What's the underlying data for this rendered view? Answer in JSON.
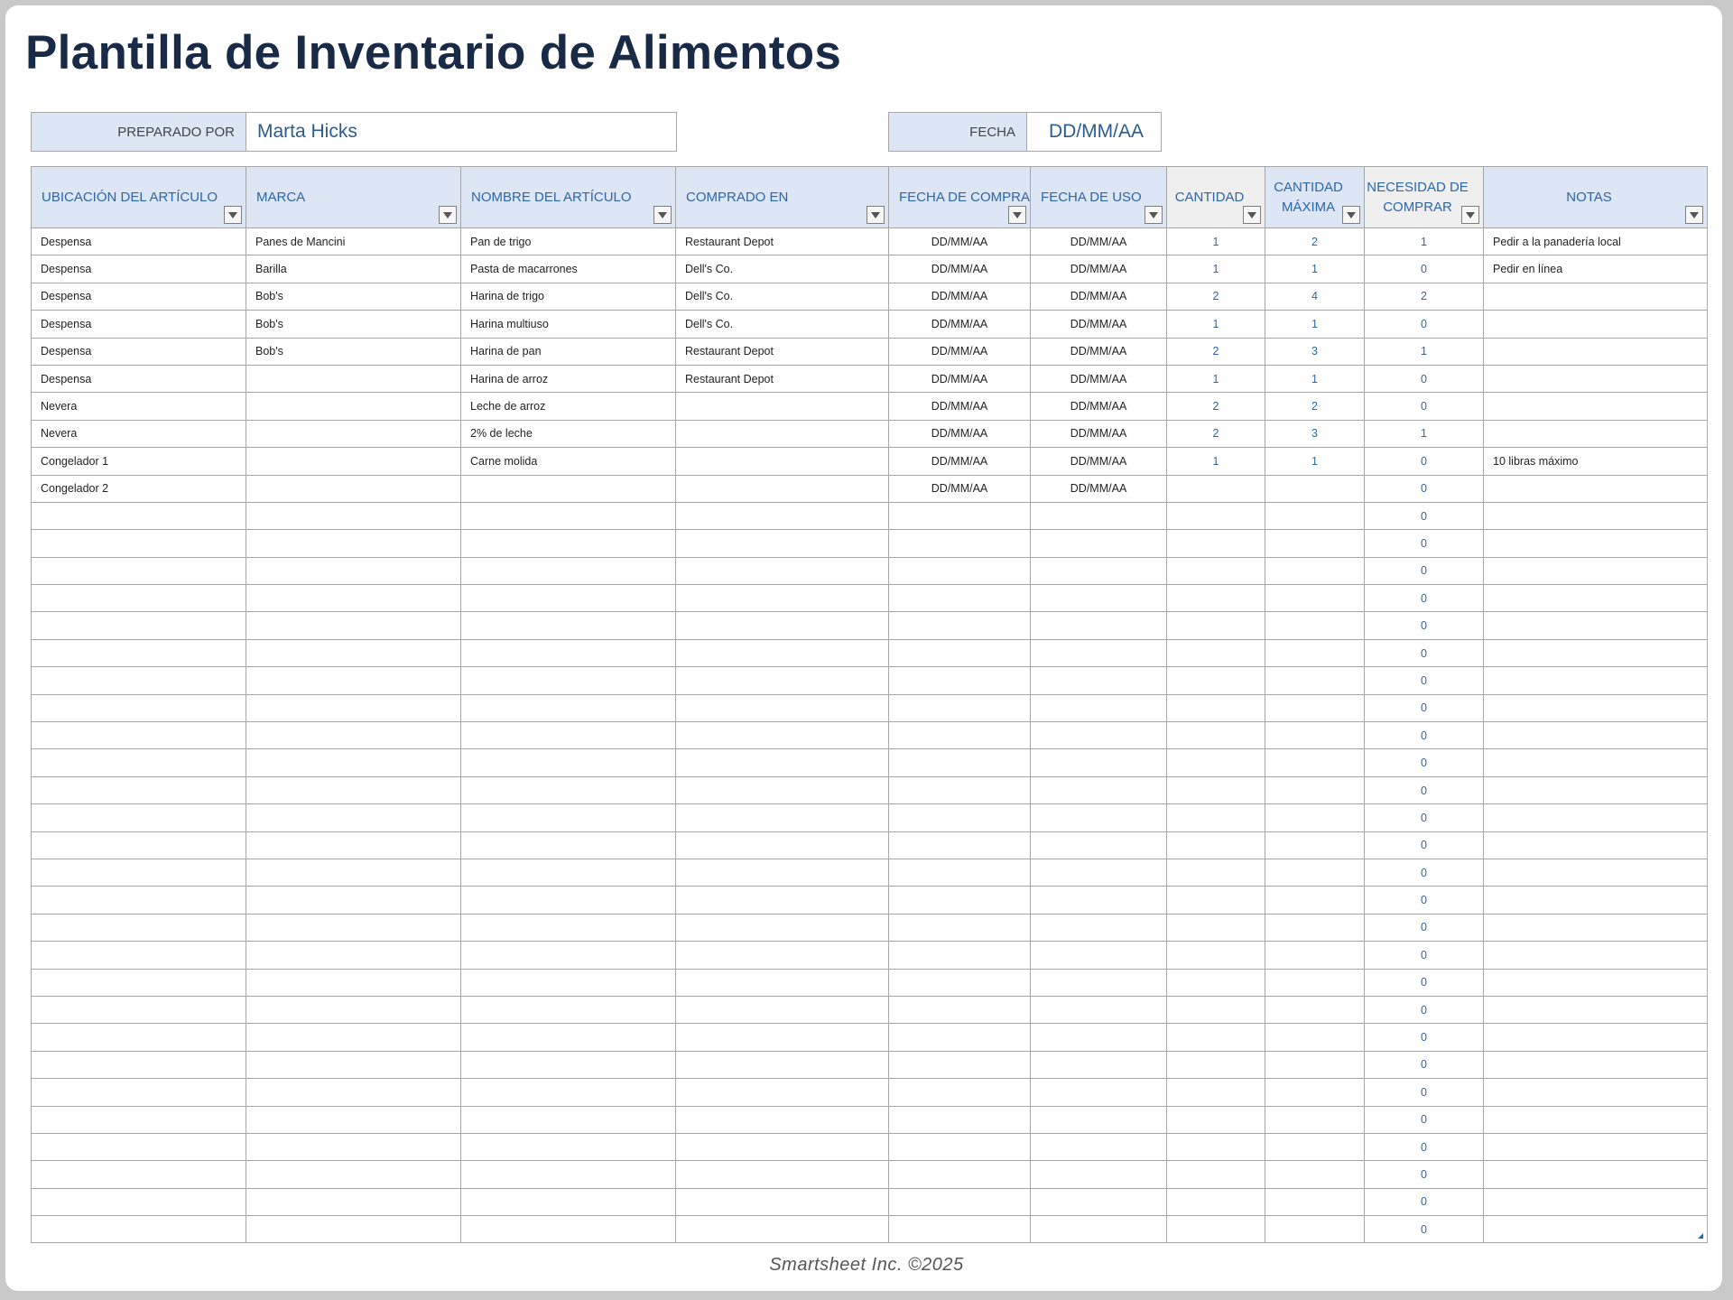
{
  "title": "Plantilla de Inventario de Alimentos",
  "prepared_by": {
    "label": "PREPARADO POR",
    "value": "Marta Hicks"
  },
  "date": {
    "label": "FECHA",
    "value": "DD/MM/AA"
  },
  "columns": [
    "UBICACIÓN DEL ARTÍCULO",
    "MARCA",
    "NOMBRE DEL ARTÍCULO",
    "COMPRADO EN",
    "FECHA DE COMPRA",
    "FECHA DE USO",
    "CANTIDAD",
    "CANTIDAD MÁXIMA",
    "NECESIDAD DE COMPRAR",
    "NOTAS"
  ],
  "rows": [
    [
      "Despensa",
      "Panes de Mancini",
      "Pan de trigo",
      "Restaurant Depot",
      "DD/MM/AA",
      "DD/MM/AA",
      "1",
      "2",
      "1",
      "Pedir a la panadería local"
    ],
    [
      "Despensa",
      "Barilla",
      "Pasta de macarrones",
      "Dell's Co.",
      "DD/MM/AA",
      "DD/MM/AA",
      "1",
      "1",
      "0",
      "Pedir en línea"
    ],
    [
      "Despensa",
      "Bob's",
      "Harina de trigo",
      "Dell's Co.",
      "DD/MM/AA",
      "DD/MM/AA",
      "2",
      "4",
      "2",
      ""
    ],
    [
      "Despensa",
      "Bob's",
      "Harina multiuso",
      "Dell's Co.",
      "DD/MM/AA",
      "DD/MM/AA",
      "1",
      "1",
      "0",
      ""
    ],
    [
      "Despensa",
      "Bob's",
      "Harina de pan",
      "Restaurant Depot",
      "DD/MM/AA",
      "DD/MM/AA",
      "2",
      "3",
      "1",
      ""
    ],
    [
      "Despensa",
      "",
      "Harina de arroz",
      "Restaurant Depot",
      "DD/MM/AA",
      "DD/MM/AA",
      "1",
      "1",
      "0",
      ""
    ],
    [
      "Nevera",
      "",
      "Leche de arroz",
      "",
      "DD/MM/AA",
      "DD/MM/AA",
      "2",
      "2",
      "0",
      ""
    ],
    [
      "Nevera",
      "",
      "2% de leche",
      "",
      "DD/MM/AA",
      "DD/MM/AA",
      "2",
      "3",
      "1",
      ""
    ],
    [
      "Congelador 1",
      "",
      "Carne molida",
      "",
      "DD/MM/AA",
      "DD/MM/AA",
      "1",
      "1",
      "0",
      "10 libras máximo"
    ],
    [
      "Congelador 2",
      "",
      "",
      "",
      "DD/MM/AA",
      "DD/MM/AA",
      "",
      "",
      "0",
      ""
    ],
    [
      "",
      "",
      "",
      "",
      "",
      "",
      "",
      "",
      "0",
      ""
    ],
    [
      "",
      "",
      "",
      "",
      "",
      "",
      "",
      "",
      "0",
      ""
    ],
    [
      "",
      "",
      "",
      "",
      "",
      "",
      "",
      "",
      "0",
      ""
    ],
    [
      "",
      "",
      "",
      "",
      "",
      "",
      "",
      "",
      "0",
      ""
    ],
    [
      "",
      "",
      "",
      "",
      "",
      "",
      "",
      "",
      "0",
      ""
    ],
    [
      "",
      "",
      "",
      "",
      "",
      "",
      "",
      "",
      "0",
      ""
    ],
    [
      "",
      "",
      "",
      "",
      "",
      "",
      "",
      "",
      "0",
      ""
    ],
    [
      "",
      "",
      "",
      "",
      "",
      "",
      "",
      "",
      "0",
      ""
    ],
    [
      "",
      "",
      "",
      "",
      "",
      "",
      "",
      "",
      "0",
      ""
    ],
    [
      "",
      "",
      "",
      "",
      "",
      "",
      "",
      "",
      "0",
      ""
    ],
    [
      "",
      "",
      "",
      "",
      "",
      "",
      "",
      "",
      "0",
      ""
    ],
    [
      "",
      "",
      "",
      "",
      "",
      "",
      "",
      "",
      "0",
      ""
    ],
    [
      "",
      "",
      "",
      "",
      "",
      "",
      "",
      "",
      "0",
      ""
    ],
    [
      "",
      "",
      "",
      "",
      "",
      "",
      "",
      "",
      "0",
      ""
    ],
    [
      "",
      "",
      "",
      "",
      "",
      "",
      "",
      "",
      "0",
      ""
    ],
    [
      "",
      "",
      "",
      "",
      "",
      "",
      "",
      "",
      "0",
      ""
    ],
    [
      "",
      "",
      "",
      "",
      "",
      "",
      "",
      "",
      "0",
      ""
    ],
    [
      "",
      "",
      "",
      "",
      "",
      "",
      "",
      "",
      "0",
      ""
    ],
    [
      "",
      "",
      "",
      "",
      "",
      "",
      "",
      "",
      "0",
      ""
    ],
    [
      "",
      "",
      "",
      "",
      "",
      "",
      "",
      "",
      "0",
      ""
    ],
    [
      "",
      "",
      "",
      "",
      "",
      "",
      "",
      "",
      "0",
      ""
    ],
    [
      "",
      "",
      "",
      "",
      "",
      "",
      "",
      "",
      "0",
      ""
    ],
    [
      "",
      "",
      "",
      "",
      "",
      "",
      "",
      "",
      "0",
      ""
    ],
    [
      "",
      "",
      "",
      "",
      "",
      "",
      "",
      "",
      "0",
      ""
    ],
    [
      "",
      "",
      "",
      "",
      "",
      "",
      "",
      "",
      "0",
      ""
    ],
    [
      "",
      "",
      "",
      "",
      "",
      "",
      "",
      "",
      "0",
      ""
    ],
    [
      "",
      "",
      "",
      "",
      "",
      "",
      "",
      "",
      "0",
      ""
    ]
  ],
  "footer": "Smartsheet Inc. ©2025",
  "colors": {
    "title": "#182a45",
    "header_fill": "#dce6f4",
    "accent": "#2d66a8"
  }
}
